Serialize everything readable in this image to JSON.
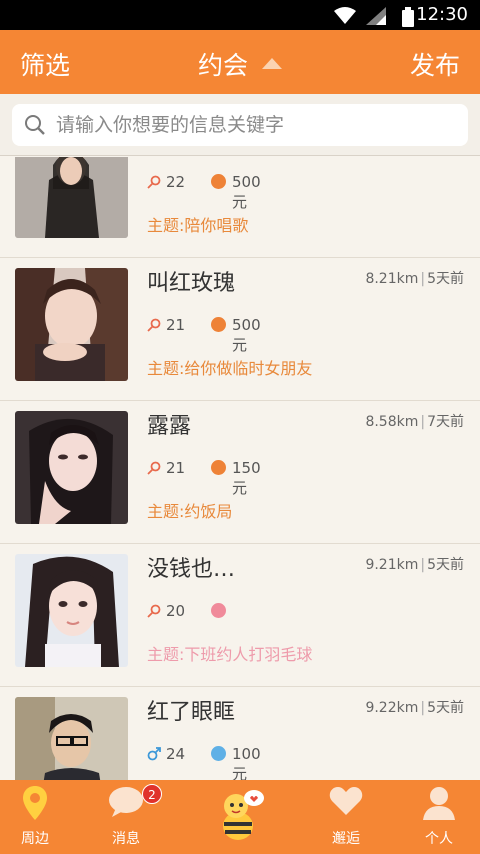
{
  "status": {
    "time": "12:30"
  },
  "header": {
    "filter": "筛选",
    "title": "约会",
    "publish": "发布"
  },
  "search": {
    "placeholder": "请输入你想要的信息关键字"
  },
  "dates": [
    {
      "name": "",
      "distance": "",
      "when": "",
      "age": "22",
      "price": "500元",
      "topic": "主题:陪你唱歌",
      "gender_color": "#e86a4d",
      "pay_color": "#ee8237",
      "topic_color": "#e8893b"
    },
    {
      "name": "叫红玫瑰",
      "distance": "8.21km",
      "when": "5天前",
      "age": "21",
      "price": "500元",
      "topic": "主题:给你做临时女朋友",
      "gender_color": "#e86a4d",
      "pay_color": "#ee8237",
      "topic_color": "#e8893b"
    },
    {
      "name": "露露",
      "distance": "8.58km",
      "when": "7天前",
      "age": "21",
      "price": "150元",
      "topic": "主题:约饭局",
      "gender_color": "#e86a4d",
      "pay_color": "#ee8237",
      "topic_color": "#e8893b"
    },
    {
      "name": "没钱也…",
      "distance": "9.21km",
      "when": "5天前",
      "age": "20",
      "price": "",
      "topic": "主题:下班约人打羽毛球",
      "gender_color": "#e86a4d",
      "pay_color": "#f08a9a",
      "topic_color": "#ee9bab"
    },
    {
      "name": "红了眼眶",
      "distance": "9.22km",
      "when": "5天前",
      "age": "24",
      "price": "100元",
      "topic": "",
      "gender_color": "#3d98d8",
      "pay_color": "#5fb0e6",
      "topic_color": "#e8893b"
    }
  ],
  "tabs": {
    "nearby": "周边",
    "messages": "消息",
    "messages_badge": "2",
    "encounter": "邂逅",
    "profile": "个人"
  },
  "colors": {
    "accent": "#f58634"
  }
}
